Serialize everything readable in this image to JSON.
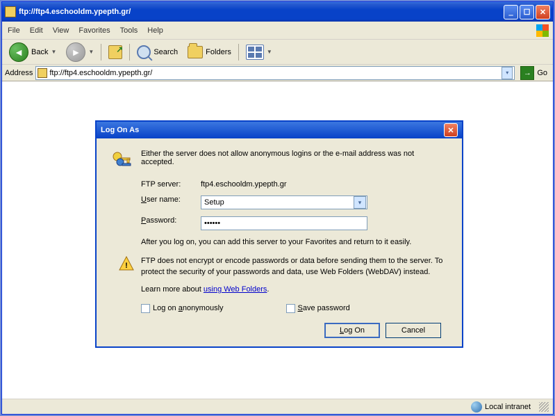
{
  "window": {
    "title": "ftp://ftp4.eschooldm.ypepth.gr/"
  },
  "menu": {
    "file": "File",
    "edit": "Edit",
    "view": "View",
    "favorites": "Favorites",
    "tools": "Tools",
    "help": "Help"
  },
  "toolbar": {
    "back": "Back",
    "search": "Search",
    "folders": "Folders"
  },
  "address": {
    "label": "Address",
    "value": "ftp://ftp4.eschooldm.ypepth.gr/",
    "go": "Go"
  },
  "dialog": {
    "title": "Log On As",
    "message": "Either the server does not allow anonymous logins or the e-mail address was not accepted.",
    "server_label": "FTP server:",
    "server_value": "ftp4.eschooldm.ypepth.gr",
    "user_pre": "U",
    "user_mid": "ser name:",
    "pass_pre": "P",
    "pass_mid": "assword:",
    "user_value": "Setup",
    "pass_value": "••••••",
    "after": "After you log on, you can add this server to your Favorites and return to it easily.",
    "warning": "FTP does not encrypt or encode passwords or data before sending them to the server.  To protect the security of your passwords and data, use Web Folders (WebDAV) instead.",
    "learn_pre": "Learn more about ",
    "learn_link": "using Web Folders",
    "anon_pre": "Log on ",
    "anon_u": "a",
    "anon_post": "nonymously",
    "save_u": "S",
    "save_post": "ave password",
    "logon_u": "L",
    "logon_post": "og On",
    "cancel": "Cancel"
  },
  "status": {
    "zone": "Local intranet"
  }
}
